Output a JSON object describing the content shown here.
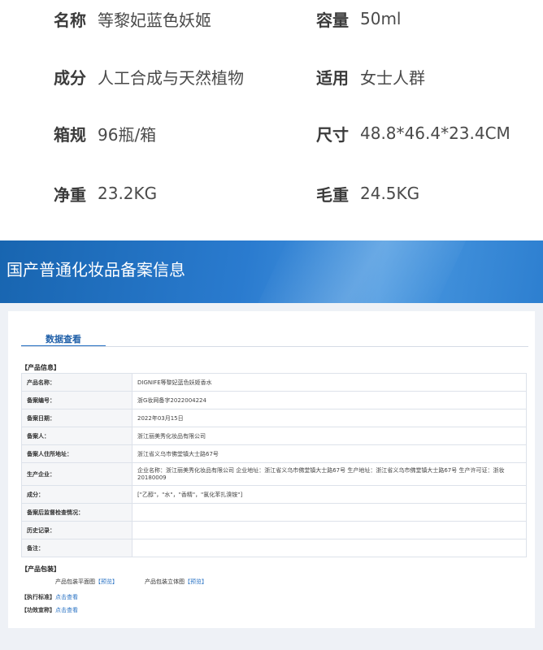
{
  "specs": [
    {
      "key": "名称",
      "value": "等黎妃蓝色妖姬"
    },
    {
      "key": "容量",
      "value": "50ml"
    },
    {
      "key": "成分",
      "value": "人工合成与天然植物"
    },
    {
      "key": "适用",
      "value": "女士人群"
    },
    {
      "key": "箱规",
      "value": "96瓶/箱"
    },
    {
      "key": "尺寸",
      "value": "48.8*46.4*23.4CM"
    },
    {
      "key": "净重",
      "value": "23.2KG"
    },
    {
      "key": "毛重",
      "value": "24.5KG"
    }
  ],
  "banner": {
    "title": "国产普通化妆品备案信息"
  },
  "panel": {
    "tab": "数据查看",
    "product_info_heading": "【产品信息】",
    "rows": [
      {
        "label": "产品名称：",
        "value": "DIGNIFE等黎妃蓝色妖姬香水"
      },
      {
        "label": "备案编号：",
        "value": "浙G妆网备字2022004224"
      },
      {
        "label": "备案日期：",
        "value": "2022年03月15日"
      },
      {
        "label": "备案人：",
        "value": "浙江丽美秀化妆品有限公司"
      },
      {
        "label": "备案人住所地址：",
        "value": "浙江省义乌市佛堂镇大士路67号"
      },
      {
        "label": "生产企业：",
        "value": "企业名称：浙江丽美秀化妆品有限公司 企业地址：浙江省义乌市佛堂镇大士路67号 生产地址：浙江省义乌市佛堂镇大士路67号 生产许可证：浙妆 20180009"
      },
      {
        "label": "成分：",
        "value": "[\"乙醇\"，\"水\"，\"香精\"，\"氯化苯扎溴铵\"]"
      },
      {
        "label": "备案后监督检查情况：",
        "value": ""
      },
      {
        "label": "历史记录：",
        "value": ""
      },
      {
        "label": "备注：",
        "value": ""
      }
    ],
    "packaging_heading": "【产品包装】",
    "pack_flat_label": "产品包装平面图",
    "pack_3d_label": "产品包装立体图",
    "preview_text": "【预览】",
    "standard_heading": "【执行标准】",
    "efficacy_heading": "【功效宣称】",
    "click_view": "点击查看"
  }
}
